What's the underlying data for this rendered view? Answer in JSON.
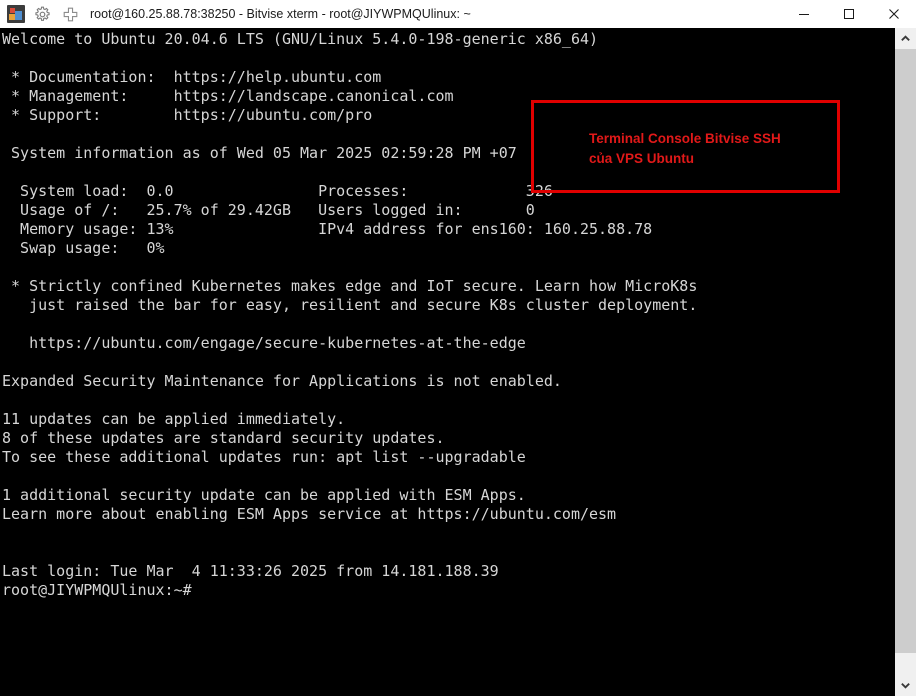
{
  "window": {
    "title": "root@160.25.88.78:38250 - Bitvise xterm - root@JIYWPMQUlinux: ~",
    "icons": {
      "app_logo": "bitvise-logo-icon",
      "settings": "gear-icon",
      "new_tab": "plus-icon"
    },
    "controls": {
      "minimize": "minimize-icon",
      "maximize": "maximize-icon",
      "close": "close-icon"
    }
  },
  "terminal": {
    "foreground_color": "#d6d6d6",
    "background_color": "#000000",
    "lines": [
      "Welcome to Ubuntu 20.04.6 LTS (GNU/Linux 5.4.0-198-generic x86_64)",
      "",
      " * Documentation:  https://help.ubuntu.com",
      " * Management:     https://landscape.canonical.com",
      " * Support:        https://ubuntu.com/pro",
      "",
      " System information as of Wed 05 Mar 2025 02:59:28 PM +07",
      "",
      "  System load:  0.0                Processes:             326",
      "  Usage of /:   25.7% of 29.42GB   Users logged in:       0",
      "  Memory usage: 13%                IPv4 address for ens160: 160.25.88.78",
      "  Swap usage:   0%",
      "",
      " * Strictly confined Kubernetes makes edge and IoT secure. Learn how MicroK8s",
      "   just raised the bar for easy, resilient and secure K8s cluster deployment.",
      "",
      "   https://ubuntu.com/engage/secure-kubernetes-at-the-edge",
      "",
      "Expanded Security Maintenance for Applications is not enabled.",
      "",
      "11 updates can be applied immediately.",
      "8 of these updates are standard security updates.",
      "To see these additional updates run: apt list --upgradable",
      "",
      "1 additional security update can be applied with ESM Apps.",
      "Learn more about enabling ESM Apps service at https://ubuntu.com/esm",
      "",
      "",
      "Last login: Tue Mar  4 11:33:26 2025 from 14.181.188.39",
      "root@JIYWPMQUlinux:~#"
    ],
    "system_info": {
      "timestamp": "Wed 05 Mar 2025 02:59:28 PM +07",
      "system_load": "0.0",
      "usage_of_root": "25.7% of 29.42GB",
      "memory_usage": "13%",
      "swap_usage": "0%",
      "processes": "326",
      "users_logged_in": "0",
      "ipv4_interface": "ens160",
      "ipv4_address": "160.25.88.78"
    },
    "os_release": "Ubuntu 20.04.6 LTS",
    "kernel": "GNU/Linux 5.4.0-198-generic x86_64",
    "prompt": "root@JIYWPMQUlinux:~#",
    "last_login": "Tue Mar  4 11:33:26 2025 from 14.181.188.39",
    "updates": {
      "immediate": "11",
      "standard_security": "8",
      "esm_additional": "1"
    }
  },
  "annotation": {
    "text": "Terminal Console Bitvise SSH\ncủa VPS Ubuntu",
    "border_color": "#e00000",
    "text_color": "#e11919"
  },
  "scrollbar": {
    "up_arrow": "chevron-up-icon",
    "down_arrow": "chevron-down-icon",
    "thumb": "scroll-thumb"
  }
}
